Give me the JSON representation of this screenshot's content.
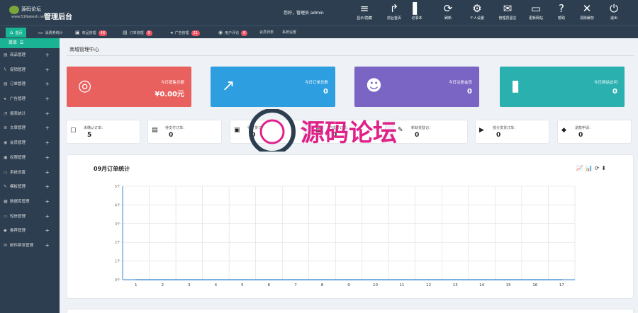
{
  "header": {
    "logo_cn": "源码论坛",
    "logo_url": "www.51Nakesh.net",
    "title": "管理后台",
    "welcome": "您好，管理员 admin",
    "buttons": [
      {
        "label": "显示/隐藏",
        "icon": "≡",
        "name": "menu-icon"
      },
      {
        "label": "前台首页",
        "icon": "↱",
        "name": "share-icon"
      },
      {
        "label": "记事本",
        "icon": "▌",
        "name": "notebook-icon"
      },
      {
        "label": "刷新",
        "icon": "⟳",
        "name": "refresh-icon"
      },
      {
        "label": "个人设置",
        "icon": "⚙",
        "name": "gear-icon"
      },
      {
        "label": "管理员留言",
        "icon": "✉",
        "name": "message-icon"
      },
      {
        "label": "更新网站",
        "icon": "▭",
        "name": "monitor-icon"
      },
      {
        "label": "帮助",
        "icon": "?",
        "name": "help-icon"
      },
      {
        "label": "清除缓存",
        "icon": "✕",
        "name": "clear-cache-icon"
      },
      {
        "label": "退出",
        "icon": "⏻",
        "name": "power-icon"
      }
    ]
  },
  "tabs": [
    {
      "label": "首页",
      "icon": "⌂",
      "badge": "",
      "name": "tab-home"
    },
    {
      "label": "消费券统计",
      "icon": "▭",
      "badge": "",
      "name": "tab-coupon-stats"
    },
    {
      "label": "商品管理",
      "icon": "▣",
      "badge": "48",
      "name": "tab-goods"
    },
    {
      "label": "订单管理",
      "icon": "▤",
      "badge": "5",
      "name": "tab-orders"
    },
    {
      "label": "广告管理",
      "icon": "◂",
      "badge": "21",
      "name": "tab-ads"
    },
    {
      "label": "用户评论",
      "icon": "◉",
      "badge": "8",
      "name": "tab-comments"
    },
    {
      "label": "会员列表",
      "icon": "",
      "badge": "",
      "name": "tab-members"
    },
    {
      "label": "系统设置",
      "icon": "",
      "badge": "",
      "name": "tab-settings"
    }
  ],
  "sidebar": {
    "head": "菜单",
    "items": [
      {
        "label": "商品管理",
        "icon": "▤"
      },
      {
        "label": "促销管理",
        "icon": "ϟ"
      },
      {
        "label": "订单管理",
        "icon": "▤"
      },
      {
        "label": "广告管理",
        "icon": "◂"
      },
      {
        "label": "报表统计",
        "icon": "◔"
      },
      {
        "label": "文章管理",
        "icon": "≣"
      },
      {
        "label": "会员管理",
        "icon": "◉"
      },
      {
        "label": "权限管理",
        "icon": "▣"
      },
      {
        "label": "系统设置",
        "icon": "▭"
      },
      {
        "label": "模板管理",
        "icon": "✎"
      },
      {
        "label": "数据库管理",
        "icon": "▦"
      },
      {
        "label": "短信管理",
        "icon": "▭"
      },
      {
        "label": "推荐管理",
        "icon": "◆"
      },
      {
        "label": "邮件群发管理",
        "icon": "✉"
      }
    ]
  },
  "main": {
    "title": "商城管理中心",
    "stats": [
      {
        "label": "今日销售总额",
        "value": "¥0.00元",
        "color": "#e8615e",
        "icon": "◎",
        "name": "stat-today-sales"
      },
      {
        "label": "今日订单总数",
        "value": "0",
        "color": "#2d9ee0",
        "icon": "↗",
        "name": "stat-today-orders"
      },
      {
        "label": "今日注册会员",
        "value": "0",
        "color": "#7b65c4",
        "icon": "☻",
        "name": "stat-today-members"
      },
      {
        "label": "今日网站访问",
        "value": "0",
        "color": "#2bb0b0",
        "icon": "▮",
        "name": "stat-today-visits"
      }
    ],
    "mini_stats": [
      {
        "label": "未确认订单：",
        "value": "5",
        "icon": "▢"
      },
      {
        "label": "待支付订单：",
        "value": "0",
        "icon": "▤"
      },
      {
        "label": "待发货订单：",
        "value": "0",
        "icon": "▣"
      },
      {
        "label": "已成交订单：",
        "value": "0",
        "icon": "▤"
      },
      {
        "label": "新缺货登记：",
        "value": "0",
        "icon": "✎"
      },
      {
        "label": "部分发货订单：",
        "value": "0",
        "icon": "▶"
      },
      {
        "label": "退款申请：",
        "value": "0",
        "icon": "◆"
      }
    ]
  },
  "watermark": {
    "text": "源码论坛"
  },
  "chart_data": {
    "type": "line",
    "title": "09月订单统计",
    "x": [
      1,
      2,
      3,
      4,
      5,
      6,
      7,
      8,
      9,
      10,
      11,
      12,
      13,
      14,
      15,
      16,
      17
    ],
    "y_ticks": [
      "0个",
      "1个",
      "2个",
      "3个",
      "4个",
      "5个"
    ],
    "ylim": [
      0,
      5
    ],
    "series": [
      {
        "values": [
          0,
          0,
          0,
          0,
          0,
          0,
          0,
          0,
          0,
          0,
          0,
          0,
          0,
          0,
          0,
          0,
          0
        ],
        "color": "#5b9bd5"
      }
    ],
    "grid": true,
    "legend": "none",
    "toolbox": [
      {
        "icon": "📈",
        "name": "line-chart-icon"
      },
      {
        "icon": "📊",
        "name": "bar-chart-icon"
      },
      {
        "icon": "⟳",
        "name": "restore-icon"
      },
      {
        "icon": "⬇",
        "name": "save-image-icon"
      }
    ]
  }
}
